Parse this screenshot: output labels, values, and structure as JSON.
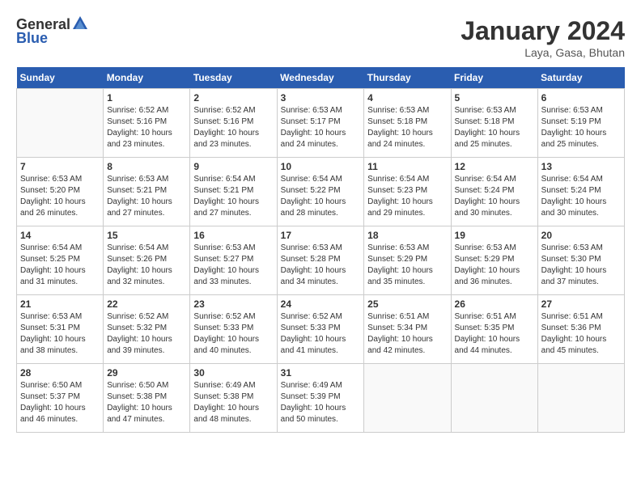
{
  "logo": {
    "general": "General",
    "blue": "Blue"
  },
  "title": "January 2024",
  "location": "Laya, Gasa, Bhutan",
  "days_of_week": [
    "Sunday",
    "Monday",
    "Tuesday",
    "Wednesday",
    "Thursday",
    "Friday",
    "Saturday"
  ],
  "weeks": [
    [
      {
        "day": "",
        "info": ""
      },
      {
        "day": "1",
        "info": "Sunrise: 6:52 AM\nSunset: 5:16 PM\nDaylight: 10 hours\nand 23 minutes."
      },
      {
        "day": "2",
        "info": "Sunrise: 6:52 AM\nSunset: 5:16 PM\nDaylight: 10 hours\nand 23 minutes."
      },
      {
        "day": "3",
        "info": "Sunrise: 6:53 AM\nSunset: 5:17 PM\nDaylight: 10 hours\nand 24 minutes."
      },
      {
        "day": "4",
        "info": "Sunrise: 6:53 AM\nSunset: 5:18 PM\nDaylight: 10 hours\nand 24 minutes."
      },
      {
        "day": "5",
        "info": "Sunrise: 6:53 AM\nSunset: 5:18 PM\nDaylight: 10 hours\nand 25 minutes."
      },
      {
        "day": "6",
        "info": "Sunrise: 6:53 AM\nSunset: 5:19 PM\nDaylight: 10 hours\nand 25 minutes."
      }
    ],
    [
      {
        "day": "7",
        "info": "Sunrise: 6:53 AM\nSunset: 5:20 PM\nDaylight: 10 hours\nand 26 minutes."
      },
      {
        "day": "8",
        "info": "Sunrise: 6:53 AM\nSunset: 5:21 PM\nDaylight: 10 hours\nand 27 minutes."
      },
      {
        "day": "9",
        "info": "Sunrise: 6:54 AM\nSunset: 5:21 PM\nDaylight: 10 hours\nand 27 minutes."
      },
      {
        "day": "10",
        "info": "Sunrise: 6:54 AM\nSunset: 5:22 PM\nDaylight: 10 hours\nand 28 minutes."
      },
      {
        "day": "11",
        "info": "Sunrise: 6:54 AM\nSunset: 5:23 PM\nDaylight: 10 hours\nand 29 minutes."
      },
      {
        "day": "12",
        "info": "Sunrise: 6:54 AM\nSunset: 5:24 PM\nDaylight: 10 hours\nand 30 minutes."
      },
      {
        "day": "13",
        "info": "Sunrise: 6:54 AM\nSunset: 5:24 PM\nDaylight: 10 hours\nand 30 minutes."
      }
    ],
    [
      {
        "day": "14",
        "info": "Sunrise: 6:54 AM\nSunset: 5:25 PM\nDaylight: 10 hours\nand 31 minutes."
      },
      {
        "day": "15",
        "info": "Sunrise: 6:54 AM\nSunset: 5:26 PM\nDaylight: 10 hours\nand 32 minutes."
      },
      {
        "day": "16",
        "info": "Sunrise: 6:53 AM\nSunset: 5:27 PM\nDaylight: 10 hours\nand 33 minutes."
      },
      {
        "day": "17",
        "info": "Sunrise: 6:53 AM\nSunset: 5:28 PM\nDaylight: 10 hours\nand 34 minutes."
      },
      {
        "day": "18",
        "info": "Sunrise: 6:53 AM\nSunset: 5:29 PM\nDaylight: 10 hours\nand 35 minutes."
      },
      {
        "day": "19",
        "info": "Sunrise: 6:53 AM\nSunset: 5:29 PM\nDaylight: 10 hours\nand 36 minutes."
      },
      {
        "day": "20",
        "info": "Sunrise: 6:53 AM\nSunset: 5:30 PM\nDaylight: 10 hours\nand 37 minutes."
      }
    ],
    [
      {
        "day": "21",
        "info": "Sunrise: 6:53 AM\nSunset: 5:31 PM\nDaylight: 10 hours\nand 38 minutes."
      },
      {
        "day": "22",
        "info": "Sunrise: 6:52 AM\nSunset: 5:32 PM\nDaylight: 10 hours\nand 39 minutes."
      },
      {
        "day": "23",
        "info": "Sunrise: 6:52 AM\nSunset: 5:33 PM\nDaylight: 10 hours\nand 40 minutes."
      },
      {
        "day": "24",
        "info": "Sunrise: 6:52 AM\nSunset: 5:33 PM\nDaylight: 10 hours\nand 41 minutes."
      },
      {
        "day": "25",
        "info": "Sunrise: 6:51 AM\nSunset: 5:34 PM\nDaylight: 10 hours\nand 42 minutes."
      },
      {
        "day": "26",
        "info": "Sunrise: 6:51 AM\nSunset: 5:35 PM\nDaylight: 10 hours\nand 44 minutes."
      },
      {
        "day": "27",
        "info": "Sunrise: 6:51 AM\nSunset: 5:36 PM\nDaylight: 10 hours\nand 45 minutes."
      }
    ],
    [
      {
        "day": "28",
        "info": "Sunrise: 6:50 AM\nSunset: 5:37 PM\nDaylight: 10 hours\nand 46 minutes."
      },
      {
        "day": "29",
        "info": "Sunrise: 6:50 AM\nSunset: 5:38 PM\nDaylight: 10 hours\nand 47 minutes."
      },
      {
        "day": "30",
        "info": "Sunrise: 6:49 AM\nSunset: 5:38 PM\nDaylight: 10 hours\nand 48 minutes."
      },
      {
        "day": "31",
        "info": "Sunrise: 6:49 AM\nSunset: 5:39 PM\nDaylight: 10 hours\nand 50 minutes."
      },
      {
        "day": "",
        "info": ""
      },
      {
        "day": "",
        "info": ""
      },
      {
        "day": "",
        "info": ""
      }
    ]
  ]
}
